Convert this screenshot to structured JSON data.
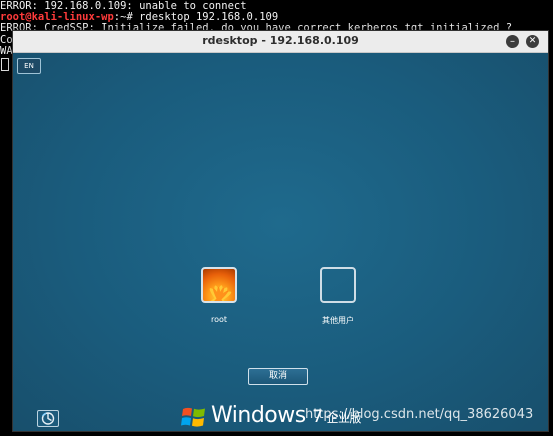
{
  "terminal": {
    "line1": "ERROR: 192.168.0.109: unable to connect",
    "prompt_user": "root@kali-linux-wp",
    "prompt_sep": ":~# ",
    "command": "rdesktop 192.168.0.109",
    "line3": "ERROR: CredSSP: Initialize failed, do you have correct kerberos tgt initialized ?",
    "line4": "Co",
    "line5": "WA"
  },
  "window": {
    "title": "rdesktop - 192.168.0.109",
    "minimize_icon": "minimize-icon",
    "close_icon": "close-icon"
  },
  "login": {
    "language": "EN",
    "users": [
      {
        "label": "root",
        "icon": "flower-avatar-icon"
      },
      {
        "label": "其他用户",
        "icon": "blank-avatar-icon"
      }
    ],
    "cancel_label": "取消",
    "ease_of_access_icon": "ease-of-access-icon",
    "brand": {
      "name": "Windows",
      "version": "7",
      "edition": "企业版"
    }
  },
  "watermark": "https://blog.csdn.net/qq_38626043",
  "colors": {
    "login_bg": "#1b5e7f",
    "titlebar_bg": "#ececec",
    "prompt_user": "#ff3b3b",
    "prompt_path": "#4a7bff"
  }
}
